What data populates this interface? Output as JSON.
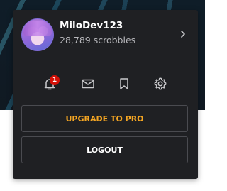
{
  "user": {
    "username": "MiloDev123",
    "scrobbles": "28,789 scrobbles"
  },
  "notifications": {
    "count": "1"
  },
  "icons": [
    "chevron-right-icon",
    "bell-icon",
    "mail-icon",
    "bookmark-icon",
    "gear-icon"
  ],
  "actions": {
    "upgrade_label": "UPGRADE TO PRO",
    "logout_label": "LOGOUT"
  },
  "colors": {
    "panel_bg": "#1f2023",
    "accent_upgrade": "#f5a623",
    "badge_red": "#d51007",
    "icon_gray": "#c9c9cc"
  }
}
